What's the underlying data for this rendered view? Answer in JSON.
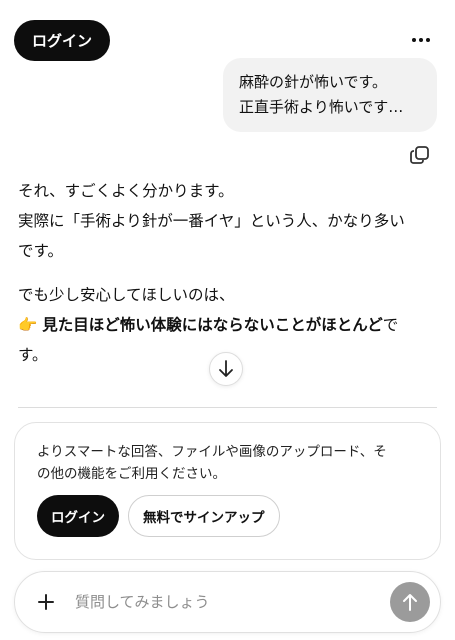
{
  "header": {
    "login_label": "ログイン",
    "more_icon": "more-horizontal-icon"
  },
  "conversation": {
    "user_message": {
      "line1": "麻酔の針が怖いです。",
      "line2": "正直手術より怖いです…"
    },
    "assistant_message": {
      "p1_line1": "それ、すごくよく分かります。",
      "p1_line2": "実際に「手術より針が一番イヤ」という人、かなり多い",
      "p1_line3": "です。",
      "p2_line1": "でも少し安心してほしいのは、",
      "p2_emoji": "👉",
      "p2_bold": "見た目ほど怖い体験にはならないことがほとんど",
      "p2_tail": "で",
      "p2_line3": "す。"
    },
    "copy_icon": "copy-icon",
    "scroll_icon": "arrow-down-icon"
  },
  "signup_prompt": {
    "message_line1": "よりスマートな回答、ファイルや画像のアップロード、そ",
    "message_line2": "の他の機能をご利用ください。",
    "login_label": "ログイン",
    "signup_label": "無料でサインアップ"
  },
  "composer": {
    "placeholder": "質問してみましょう",
    "plus_icon": "plus-icon",
    "send_icon": "arrow-up-icon"
  },
  "colors": {
    "dark_button": "#0d0d0d",
    "user_bubble": "#f2f2f2",
    "send_button": "#9b9b9b"
  }
}
